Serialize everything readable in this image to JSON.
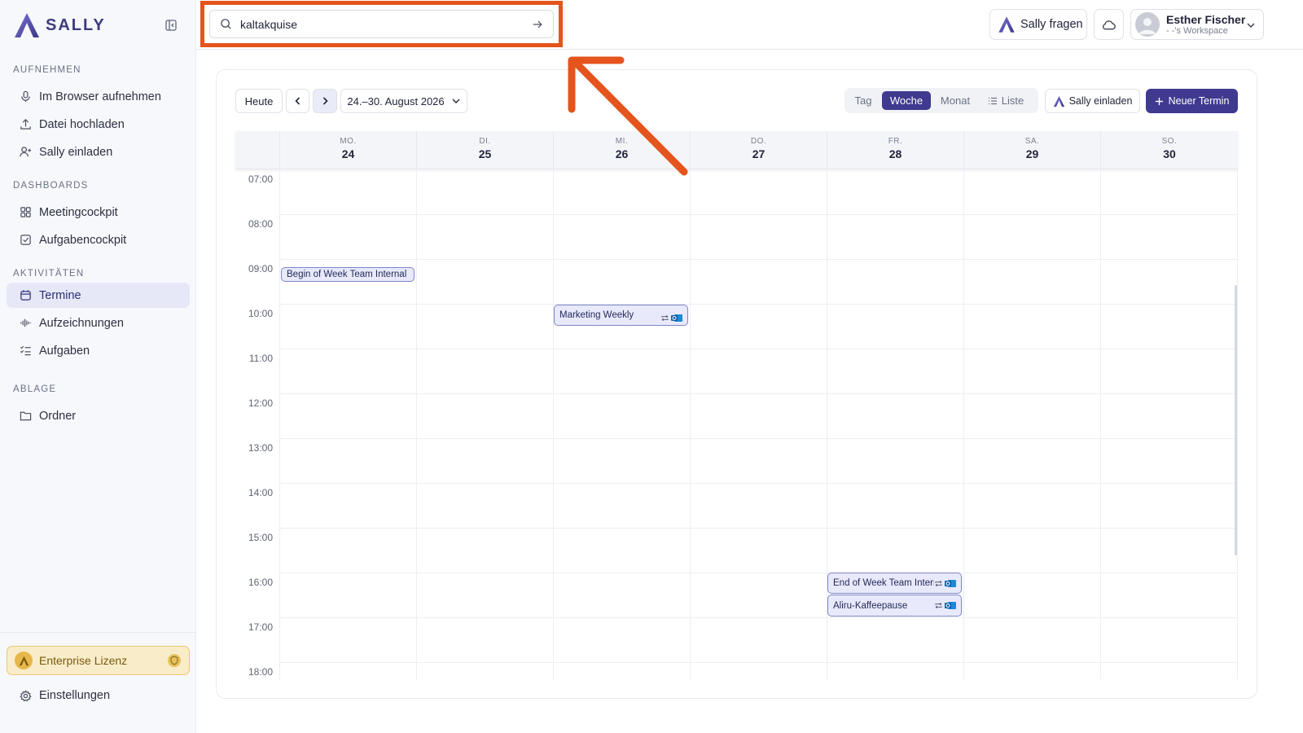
{
  "brand": {
    "name": "SALLY"
  },
  "sidebar": {
    "sections": [
      {
        "title": "AUFNEHMEN",
        "items": [
          {
            "label": "Im Browser aufnehmen",
            "icon": "microphone-icon"
          },
          {
            "label": "Datei hochladen",
            "icon": "upload-icon"
          },
          {
            "label": "Sally einladen",
            "icon": "user-plus-icon"
          }
        ]
      },
      {
        "title": "DASHBOARDS",
        "items": [
          {
            "label": "Meetingcockpit",
            "icon": "grid-icon"
          },
          {
            "label": "Aufgabencockpit",
            "icon": "checkbox-icon"
          }
        ]
      },
      {
        "title": "AKTIVITÄTEN",
        "items": [
          {
            "label": "Termine",
            "icon": "calendar-icon",
            "active": true
          },
          {
            "label": "Aufzeichnungen",
            "icon": "waveform-icon"
          },
          {
            "label": "Aufgaben",
            "icon": "task-list-icon"
          }
        ]
      },
      {
        "title": "ABLAGE",
        "items": [
          {
            "label": "Ordner",
            "icon": "folder-icon"
          }
        ]
      }
    ],
    "license": "Enterprise Lizenz",
    "settings": "Einstellungen"
  },
  "search": {
    "value": "kaltakquise",
    "placeholder": ""
  },
  "header": {
    "ask_label": "Sally fragen",
    "user_name": "Esther Fischer",
    "workspace": "- -'s Workspace"
  },
  "toolbar": {
    "today": "Heute",
    "range": "24.–30. August 2026",
    "views": [
      "Tag",
      "Woche",
      "Monat",
      "Liste"
    ],
    "active_view": "Woche",
    "invite": "Sally einladen",
    "new": "Neuer Termin"
  },
  "days": [
    {
      "name": "MO.",
      "num": "24"
    },
    {
      "name": "DI.",
      "num": "25"
    },
    {
      "name": "MI.",
      "num": "26"
    },
    {
      "name": "DO.",
      "num": "27"
    },
    {
      "name": "FR.",
      "num": "28"
    },
    {
      "name": "SA.",
      "num": "29"
    },
    {
      "name": "SO.",
      "num": "30"
    }
  ],
  "times": [
    "07:00",
    "08:00",
    "09:00",
    "10:00",
    "11:00",
    "12:00",
    "13:00",
    "14:00",
    "15:00",
    "16:00",
    "17:00",
    "18:00"
  ],
  "events": [
    {
      "title": "Begin of Week Team Internal",
      "day": 0,
      "start": "09:00",
      "recurring": false,
      "outlook": false
    },
    {
      "title": "Marketing Weekly",
      "day": 2,
      "start": "10:00",
      "recurring": true,
      "outlook": true
    },
    {
      "title": "End of Week Team Internal",
      "day": 4,
      "start": "16:00",
      "recurring": true,
      "outlook": true
    },
    {
      "title": "Aliru-Kaffeepause",
      "day": 4,
      "start": "16:30",
      "recurring": true,
      "outlook": true
    }
  ],
  "colors": {
    "accent": "#3f3a8f",
    "annotation": "#e4541c",
    "event_bg": "#e8e9fb",
    "event_border": "#7f86c7",
    "license_bg": "#f8ecc9"
  }
}
